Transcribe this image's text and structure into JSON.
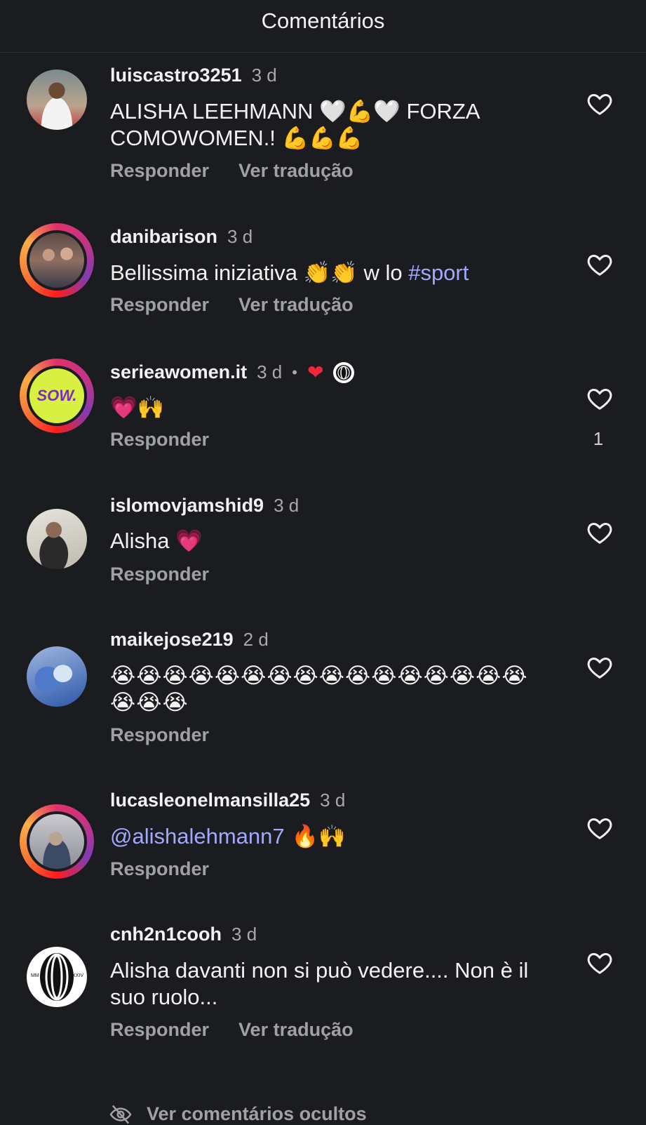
{
  "header": {
    "title": "Comentários"
  },
  "comments": [
    {
      "username": "luiscastro3251",
      "time": "3 d",
      "text_parts": [
        "ALISHA LEEHMANN ",
        "🤍💪🤍",
        " FORZA COMOWOMEN.! ",
        "💪💪💪"
      ],
      "reply": "Responder",
      "translate": "Ver tradução"
    },
    {
      "username": "danibarison",
      "time": "3 d",
      "text_parts": [
        "Bellissima iniziativa ",
        "👏👏",
        " w lo ",
        "#sport"
      ],
      "reply": "Responder",
      "translate": "Ver tradução"
    },
    {
      "username": "serieawomen.it",
      "time": "3 d",
      "dot": "•",
      "liked_heart": "❤",
      "text_parts": [
        "💗🙌"
      ],
      "reply": "Responder",
      "likes": "1",
      "avatar_text": "SOW."
    },
    {
      "username": "islomovjamshid9",
      "time": "3 d",
      "text_parts": [
        "Alisha ",
        "💗"
      ],
      "reply": "Responder"
    },
    {
      "username": "maikejose219",
      "time": "2 d",
      "text_parts": [
        "😭😭😭😭😭😭😭😭😭😭😭😭😭😭😭😭😭😭😭"
      ],
      "reply": "Responder"
    },
    {
      "username": "lucasleonelmansilla25",
      "time": "3 d",
      "text_parts": [
        "@alishalehmann7",
        " 🔥🙌"
      ],
      "reply": "Responder"
    },
    {
      "username": "cnh2n1cooh",
      "time": "3 d",
      "text_parts": [
        "Alisha davanti non si può vedere.... Non è il suo ruolo..."
      ],
      "reply": "Responder",
      "translate": "Ver tradução",
      "avatar_text_left": "MM",
      "avatar_text_right": "XXIV"
    }
  ],
  "footer": {
    "hidden_comments": "Ver comentários ocultos"
  },
  "colors": {
    "background": "#1b1c20",
    "mention": "#a3a8ff",
    "muted": "#a0a1a7",
    "liked": "#f0263c"
  },
  "icons": [
    "heart-outline-icon",
    "eye-off-icon"
  ]
}
